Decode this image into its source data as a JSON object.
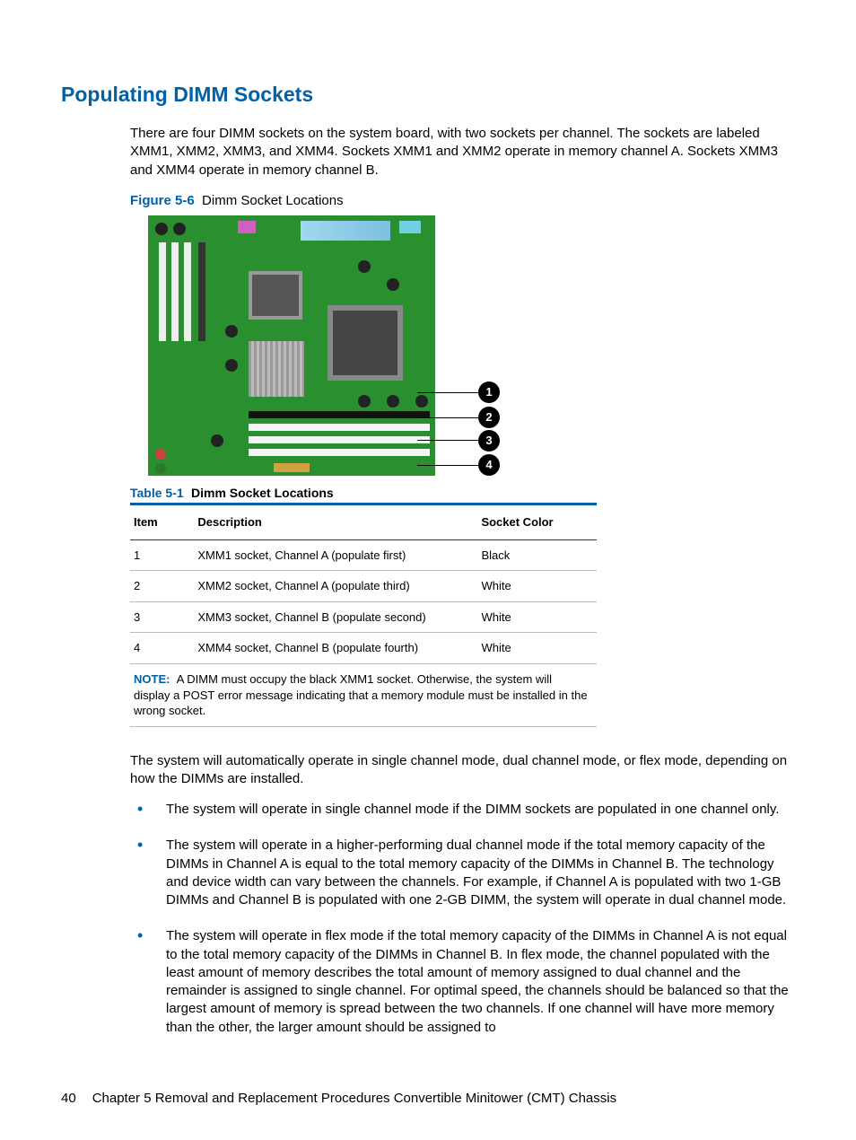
{
  "heading": "Populating DIMM Sockets",
  "intro": "There are four DIMM sockets on the system board, with two sockets per channel. The sockets are labeled XMM1, XMM2, XMM3, and XMM4. Sockets XMM1 and XMM2 operate in memory channel A. Sockets XMM3 and XMM4 operate in memory channel B.",
  "figure": {
    "label": "Figure 5-6",
    "caption": "Dimm Socket Locations"
  },
  "callouts": [
    "1",
    "2",
    "3",
    "4"
  ],
  "table": {
    "label": "Table 5-1",
    "caption": "Dimm Socket Locations",
    "headers": {
      "item": "Item",
      "desc": "Description",
      "color": "Socket Color"
    },
    "rows": [
      {
        "item": "1",
        "desc": "XMM1 socket, Channel A (populate first)",
        "color": "Black"
      },
      {
        "item": "2",
        "desc": "XMM2 socket, Channel A (populate third)",
        "color": "White"
      },
      {
        "item": "3",
        "desc": "XMM3 socket, Channel B (populate second)",
        "color": "White"
      },
      {
        "item": "4",
        "desc": "XMM4 socket, Channel B (populate fourth)",
        "color": "White"
      }
    ],
    "note_label": "NOTE:",
    "note": "A DIMM must occupy the black XMM1 socket. Otherwise, the system will display a POST error message indicating that a memory module must be installed in the wrong socket."
  },
  "body_after_table": "The system will automatically operate in single channel mode, dual channel mode, or flex mode, depending on how the DIMMs are installed.",
  "bullets": [
    "The system will operate in single channel mode if the DIMM sockets are populated in one channel only.",
    "The system will operate in a higher-performing dual channel mode if the total memory capacity of the DIMMs in Channel A is equal to the total memory capacity of the DIMMs in Channel B. The technology and device width can vary between the channels. For example, if Channel A is populated with two 1-GB DIMMs and Channel B is populated with one 2-GB DIMM, the system will operate in dual channel mode.",
    "The system will operate in flex mode if the total memory capacity of the DIMMs in Channel A is not equal to the total memory capacity of the DIMMs in Channel B. In flex mode, the channel populated with the least amount of memory describes the total amount of memory assigned to dual channel and the remainder is assigned to single channel. For optimal speed, the channels should be balanced so that the largest amount of memory is spread between the two channels. If one channel will have more memory than the other, the larger amount should be assigned to"
  ],
  "footer": {
    "page": "40",
    "chapter": "Chapter 5   Removal and Replacement Procedures Convertible Minitower (CMT) Chassis"
  }
}
